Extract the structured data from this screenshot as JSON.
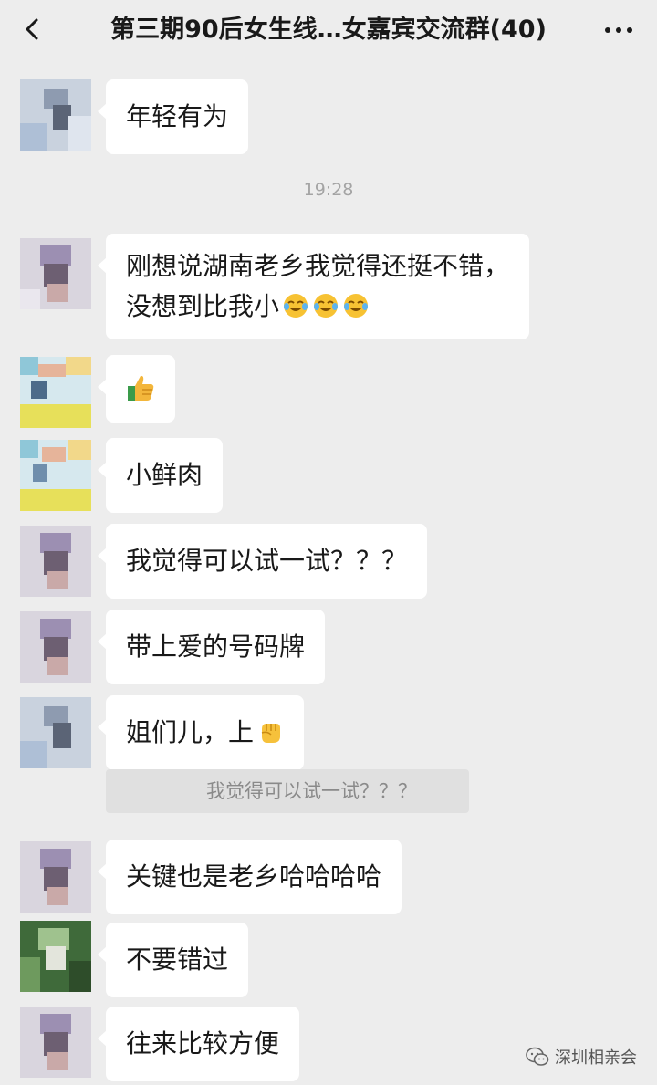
{
  "header": {
    "title": "第三期90后女生线…女嘉宾交流群(40)",
    "back_icon": "chevron-left-icon",
    "more_icon": "more-dots-icon"
  },
  "timestamp": "19:28",
  "messages": [
    {
      "text": "年轻有为",
      "avatar": "avatar-blurred"
    },
    {
      "line1": "刚想说湖南老乡我觉得还挺不错，",
      "line2": "没想到比我小",
      "emojis": [
        "laugh-cry-emoji",
        "laugh-cry-emoji",
        "laugh-cry-emoji"
      ]
    },
    {
      "text": "",
      "emojis": [
        "thumbs-up-emoji"
      ]
    },
    {
      "text": "小鲜肉"
    },
    {
      "text": "我觉得可以试一试？？？"
    },
    {
      "text": "带上爱的号码牌"
    },
    {
      "text": "姐们儿，上",
      "emojis": [
        "fist-emoji"
      ]
    },
    {
      "text": "关键也是老乡哈哈哈哈"
    },
    {
      "text": "不要错过"
    },
    {
      "text": "往来比较方便"
    }
  ],
  "quote": {
    "text": "我觉得可以试一试？？？"
  },
  "watermark": {
    "text": "深圳相亲会",
    "icon": "wechat-icon"
  },
  "colors": {
    "background": "#ededed",
    "bubble": "#ffffff",
    "quote": "#e0e0e0",
    "time": "#a4a4a4"
  }
}
